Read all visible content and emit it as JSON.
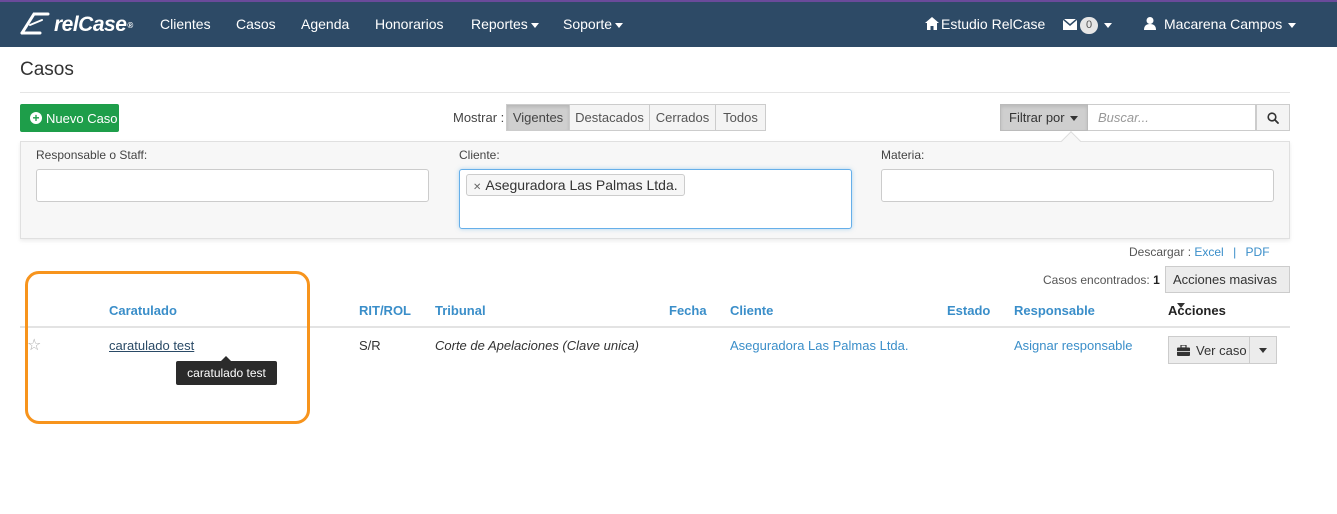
{
  "nav": {
    "brand": "relCase",
    "brand_mark": "®",
    "items": [
      "Clientes",
      "Casos",
      "Agenda",
      "Honorarios",
      "Reportes",
      "Soporte"
    ],
    "studio": "Estudio RelCase",
    "messages_count": "0",
    "user": "Macarena Campos"
  },
  "page": {
    "title": "Casos"
  },
  "toolbar": {
    "new_case": "Nuevo Caso",
    "show_label": "Mostrar :",
    "filters": [
      "Vigentes",
      "Destacados",
      "Cerrados",
      "Todos"
    ],
    "active_filter": "Vigentes",
    "filter_by": "Filtrar por",
    "search_placeholder": "Buscar..."
  },
  "filter_panel": {
    "responsable_label": "Responsable o Staff:",
    "cliente_label": "Cliente:",
    "materia_label": "Materia:",
    "cliente_tag": "Aseguradora Las Palmas Ltda."
  },
  "download": {
    "label": "Descargar :",
    "excel": "Excel",
    "separator": "|",
    "pdf": "PDF"
  },
  "results": {
    "label": "Casos encontrados:",
    "count": "1",
    "bulk_actions": "Acciones masivas"
  },
  "table": {
    "headers": [
      "Caratulado",
      "RIT/ROL",
      "Tribunal",
      "Fecha",
      "Cliente",
      "Estado",
      "Responsable",
      "Acciones"
    ],
    "rows": [
      {
        "caratulado": "caratulado test",
        "rit_rol": "S/R",
        "tribunal": "Corte de Apelaciones (Clave unica)",
        "fecha": "",
        "cliente": "Aseguradora Las Palmas Ltda.",
        "estado": "",
        "responsable": "Asignar responsable",
        "action": "Ver caso"
      }
    ],
    "tooltip": "caratulado test"
  },
  "colors": {
    "navbar": "#2d4a66",
    "accent_green": "#1e9e4a",
    "link_blue": "#3a8ec9",
    "highlight": "#f7941d"
  }
}
